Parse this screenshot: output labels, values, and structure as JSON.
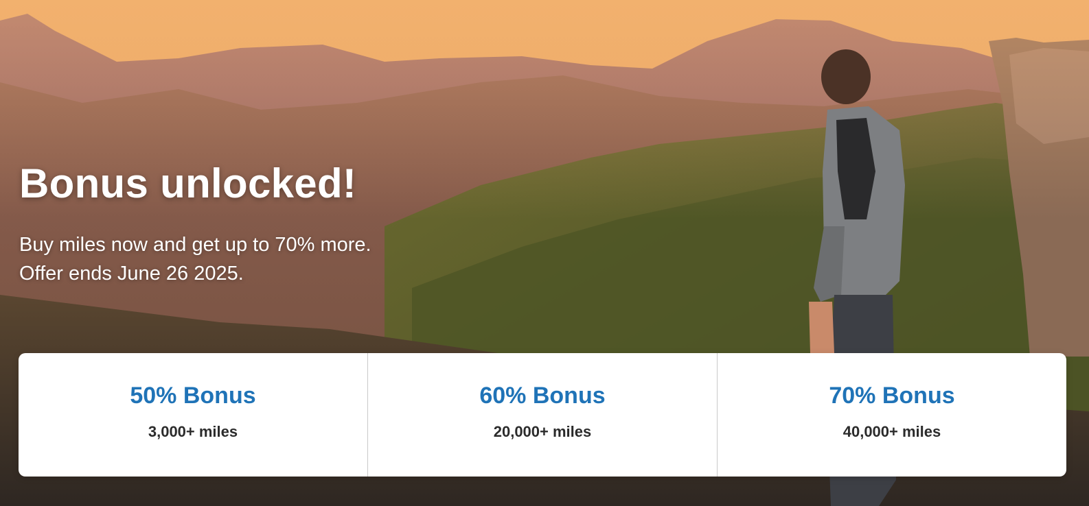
{
  "hero": {
    "headline": "Bonus unlocked!",
    "subtext_lines": [
      "Buy miles now and get up to 70% more.",
      "Offer ends June 26 2025."
    ]
  },
  "tiers": [
    {
      "title": "50% Bonus",
      "miles": "3,000+ miles"
    },
    {
      "title": "60% Bonus",
      "miles": "20,000+ miles"
    },
    {
      "title": "70% Bonus",
      "miles": "40,000+ miles"
    }
  ],
  "colors": {
    "tier_title": "#1f73b7",
    "tier_miles": "#2b2b2b",
    "card_background": "#ffffff"
  }
}
